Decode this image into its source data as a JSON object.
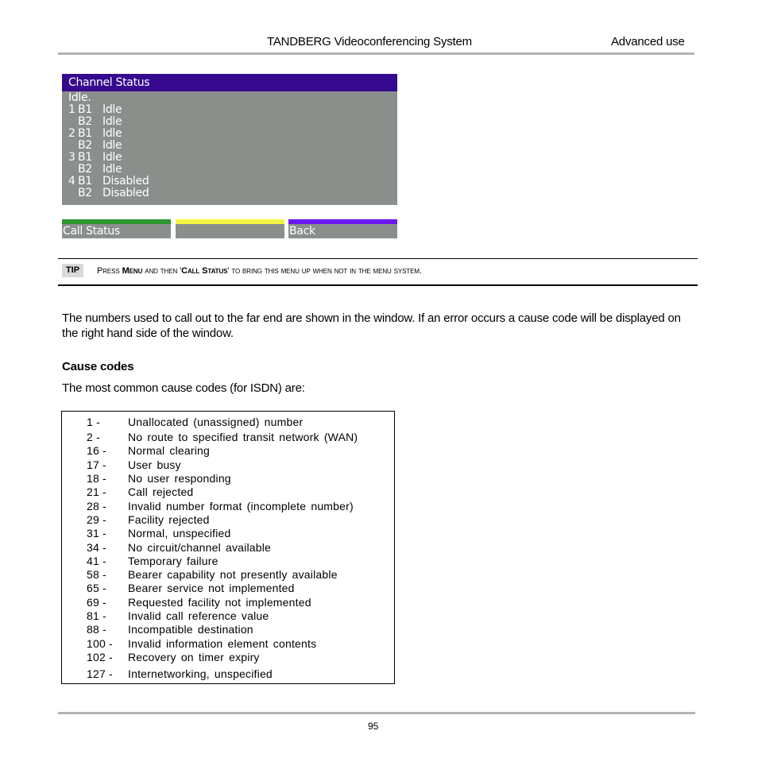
{
  "header": {
    "title": "TANDBERG Videoconferencing System",
    "section": "Advanced use"
  },
  "screen": {
    "title": "Channel Status",
    "status_line": "Idle.",
    "channels": [
      {
        "line": "1",
        "channel": "B1",
        "state": "Idle"
      },
      {
        "line": "",
        "channel": "B2",
        "state": "Idle"
      },
      {
        "line": "2",
        "channel": "B1",
        "state": "Idle"
      },
      {
        "line": "",
        "channel": "B2",
        "state": "Idle"
      },
      {
        "line": "3",
        "channel": "B1",
        "state": "Idle"
      },
      {
        "line": "",
        "channel": "B2",
        "state": "Idle"
      },
      {
        "line": "4",
        "channel": "B1",
        "state": "Disabled"
      },
      {
        "line": "",
        "channel": "B2",
        "state": "Disabled"
      }
    ],
    "softkeys": [
      {
        "label": "Call Status",
        "color": "#2e9531"
      },
      {
        "label": "",
        "color": "#f5f542"
      },
      {
        "label": "Back",
        "color": "#6a17f0"
      }
    ],
    "colors": {
      "title_bg": "#350a8f",
      "body_bg": "#8b8f8c"
    }
  },
  "tip": {
    "badge": "TIP",
    "prefix": "Press ",
    "key1": "Menu",
    "middle": " and then '",
    "key2": "Call Status",
    "suffix": "' to bring this menu up when not in the menu system."
  },
  "body": {
    "paragraph": "The numbers used to call out to the far end are shown in the window. If an error occurs a cause code will be displayed on the right hand side of the window.",
    "section_heading": "Cause codes",
    "intro": "The most common cause codes (for ISDN) are:"
  },
  "cause_codes": [
    {
      "code": "1 -",
      "description": "Unallocated (unassigned) number"
    },
    {
      "code": "2 -",
      "description": "No route to specified transit network (WAN)"
    },
    {
      "code": "16 -",
      "description": "Normal clearing"
    },
    {
      "code": "17 -",
      "description": "User busy"
    },
    {
      "code": "18 -",
      "description": "No user responding"
    },
    {
      "code": "21 -",
      "description": "Call rejected"
    },
    {
      "code": "28 -",
      "description": "Invalid number format (incomplete number)"
    },
    {
      "code": "29 -",
      "description": "Facility rejected"
    },
    {
      "code": "31 -",
      "description": "Normal, unspecified"
    },
    {
      "code": "34 -",
      "description": "No circuit/channel available"
    },
    {
      "code": "41 -",
      "description": "Temporary failure"
    },
    {
      "code": "58 -",
      "description": "Bearer capability not presently available"
    },
    {
      "code": "65 -",
      "description": "Bearer service not implemented"
    },
    {
      "code": "69 -",
      "description": "Requested facility not implemented"
    },
    {
      "code": "81 -",
      "description": "Invalid call reference value"
    },
    {
      "code": "88 -",
      "description": "Incompatible destination"
    },
    {
      "code": "100 -",
      "description": "Invalid information element contents"
    },
    {
      "code": "102 -",
      "description": "Recovery on timer expiry"
    },
    {
      "code": "127 -",
      "description": "Internetworking, unspecified"
    }
  ],
  "footer": {
    "page_number": "95"
  }
}
